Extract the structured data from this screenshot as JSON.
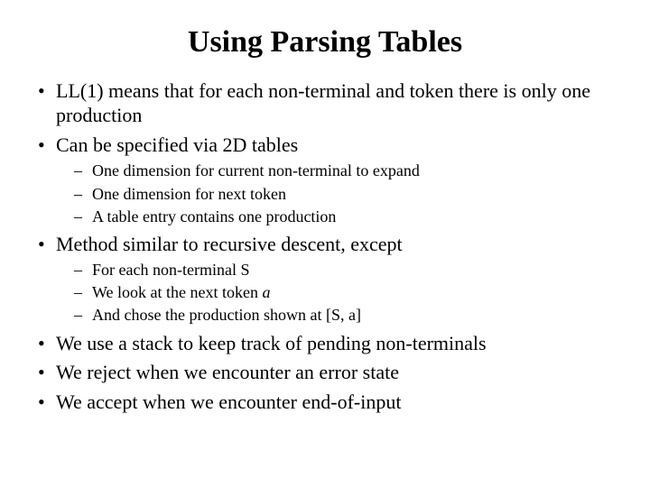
{
  "title": "Using Parsing Tables",
  "bullets": {
    "b1": "LL(1) means that for each non-terminal and token there is only one production",
    "b2": "Can be specified via 2D tables",
    "b2_sub": {
      "s1": "One dimension for current non-terminal to expand",
      "s2": "One dimension for next token",
      "s3": "A table entry contains  one production"
    },
    "b3": "Method similar to recursive descent, except",
    "b3_sub": {
      "s1": "For each non-terminal S",
      "s2_pre": "We look at the next token ",
      "s2_a": "a",
      "s3": "And chose the production shown at [S, a]"
    },
    "b4": "We use a stack to keep track of pending non-terminals",
    "b5": "We reject when we encounter an error state",
    "b6": "We accept when we encounter end-of-input"
  }
}
